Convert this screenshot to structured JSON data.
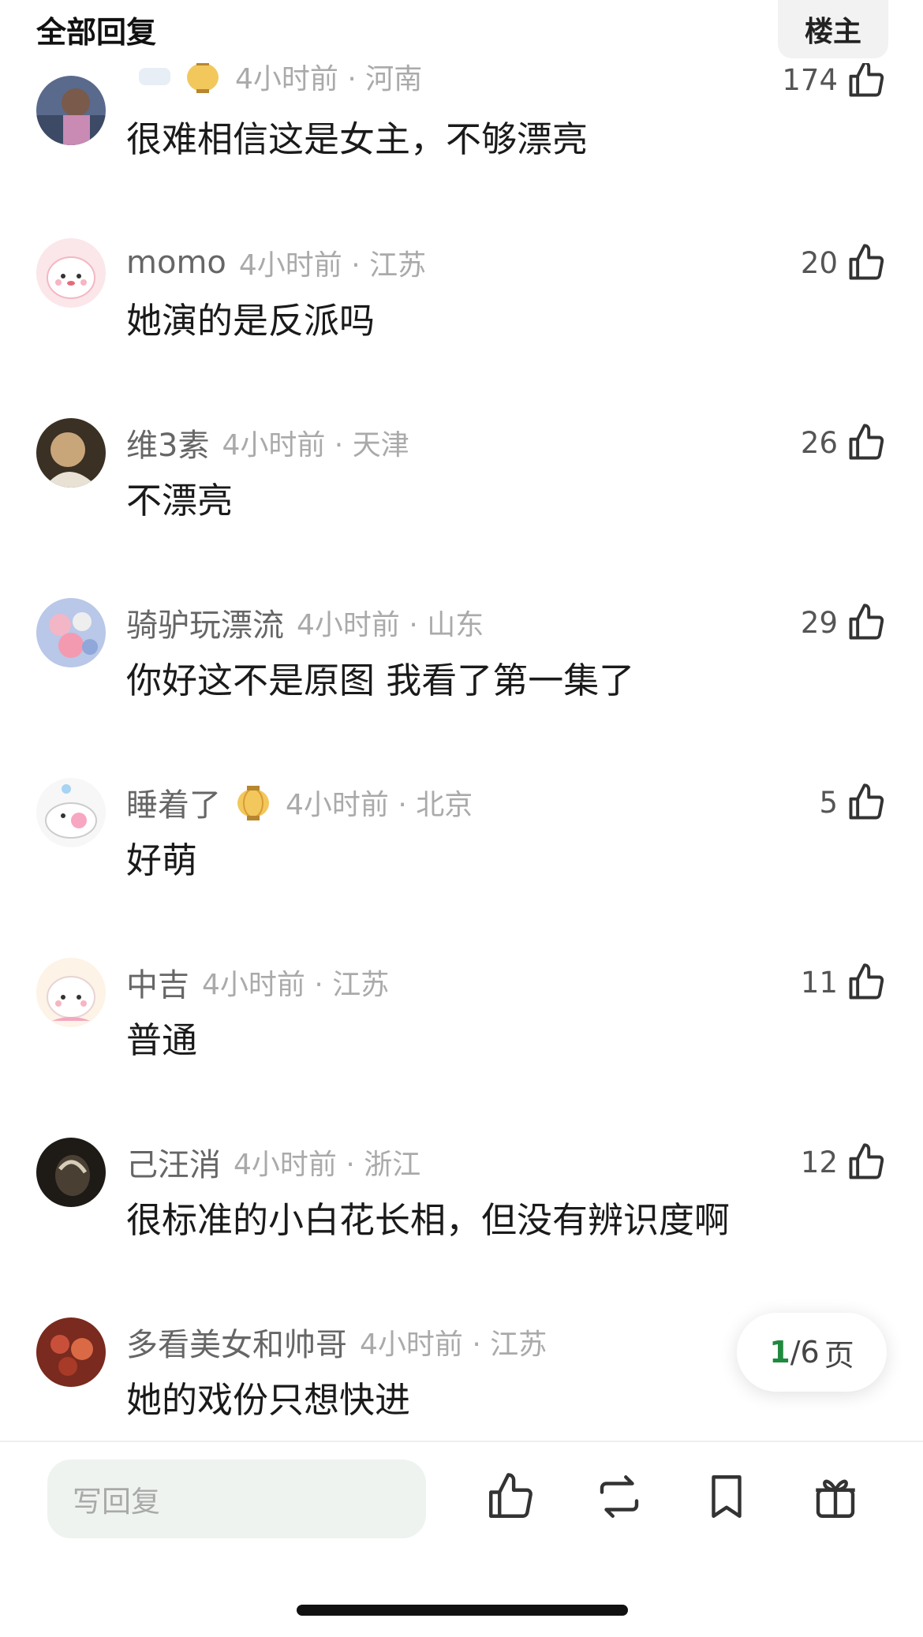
{
  "header": {
    "title": "全部回复",
    "op_button": "楼主"
  },
  "colors": {
    "accent_green": "#1f8a3e",
    "reply_box_bg": "#eef3ef",
    "muted": "#aaaaaa"
  },
  "comments": [
    {
      "username": "",
      "time": "4小时前",
      "location": "河南",
      "likes": "174",
      "text": "很难相信这是女主，不够漂亮",
      "badge": "lantern-icon",
      "avatar": "avatar-girl-icon"
    },
    {
      "username": "momo",
      "time": "4小时前",
      "location": "江苏",
      "likes": "20",
      "text": "她演的是反派吗",
      "avatar": "avatar-pink-bunny-icon"
    },
    {
      "username": "维3素",
      "time": "4小时前",
      "location": "天津",
      "likes": "26",
      "text": "不漂亮",
      "avatar": "avatar-portrait-icon"
    },
    {
      "username": "骑驴玩漂流",
      "time": "4小时前",
      "location": "山东",
      "likes": "29",
      "text": "你好这不是原图 我看了第一集了",
      "avatar": "avatar-flowers-icon"
    },
    {
      "username": "睡着了",
      "time": "4小时前",
      "location": "北京",
      "likes": "5",
      "text": "好萌",
      "badge": "lantern-icon",
      "avatar": "avatar-cartoon-icon"
    },
    {
      "username": "中吉",
      "time": "4小时前",
      "location": "江苏",
      "likes": "11",
      "text": "普通",
      "avatar": "avatar-bunny-icon"
    },
    {
      "username": "己汪消",
      "time": "4小时前",
      "location": "浙江",
      "likes": "12",
      "text": "很标准的小白花长相，但没有辨识度啊",
      "avatar": "avatar-dark-icon"
    },
    {
      "username": "多看美女和帅哥",
      "time": "4小时前",
      "location": "江苏",
      "likes": "",
      "text": "她的戏份只想快进",
      "avatar": "avatar-food-icon"
    }
  ],
  "pagination": {
    "current": "1",
    "total_text": "/6",
    "unit": "页"
  },
  "bottom_bar": {
    "reply_placeholder": "写回复",
    "icons": [
      "thumb-up-icon",
      "repost-icon",
      "bookmark-icon",
      "gift-icon"
    ]
  }
}
